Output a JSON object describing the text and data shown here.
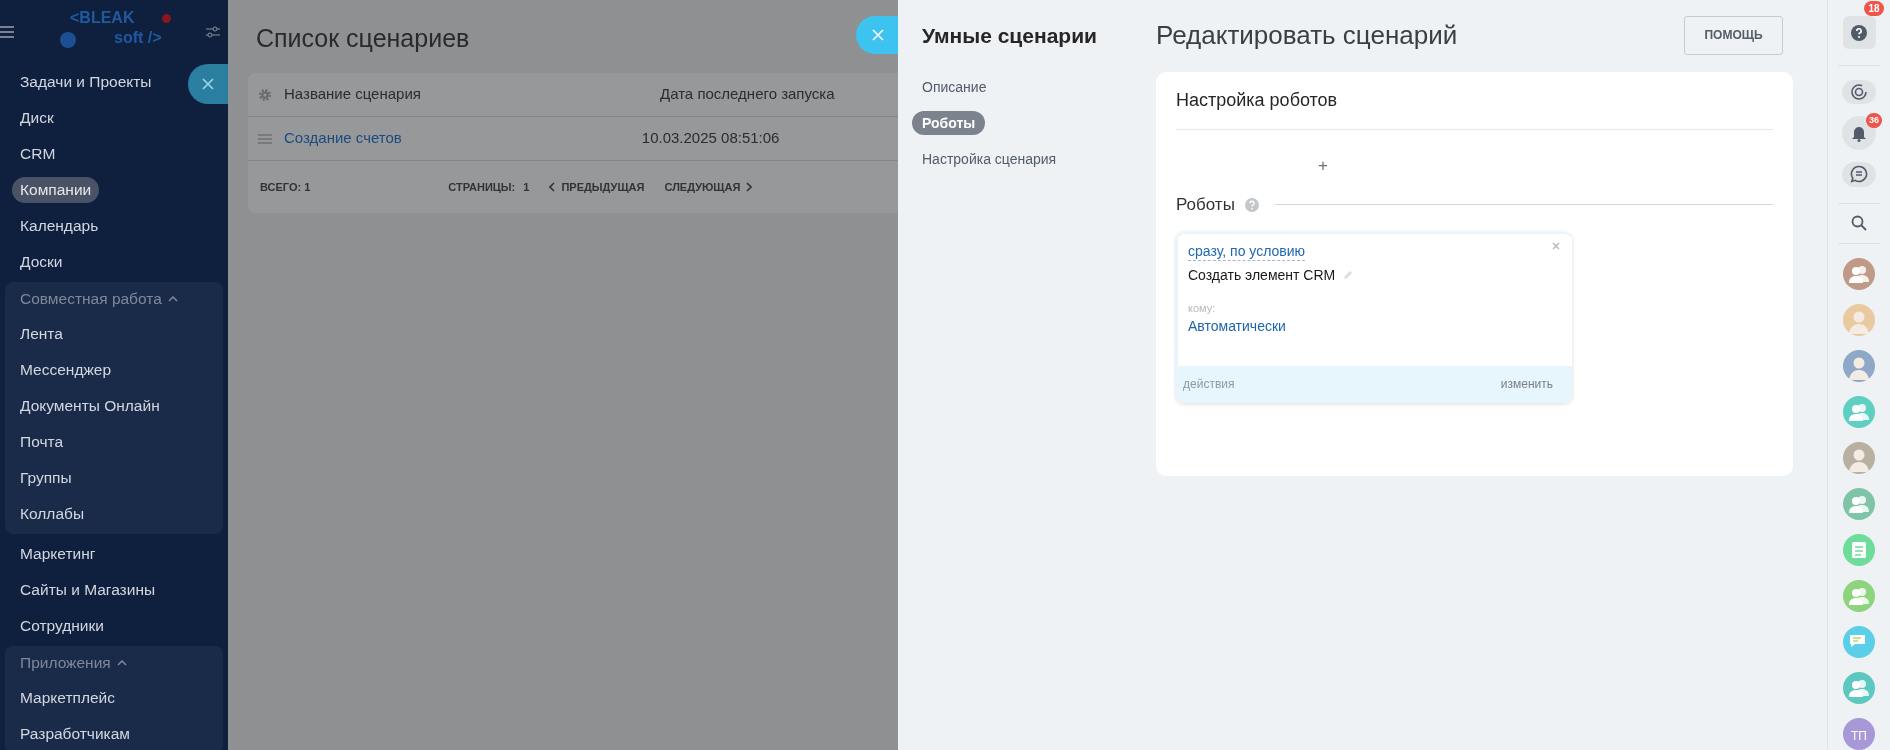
{
  "left_menu": {
    "logo": {
      "line_1": "<BLEAK",
      "line_2": "soft />"
    },
    "items": [
      {
        "kind": "link",
        "label": "Задачи и Проекты",
        "selected": false
      },
      {
        "kind": "link",
        "label": "Диск",
        "selected": false
      },
      {
        "kind": "link",
        "label": "CRM",
        "selected": false
      },
      {
        "kind": "link",
        "label": "Компании",
        "selected": true
      },
      {
        "kind": "link",
        "label": "Календарь",
        "selected": false
      },
      {
        "kind": "link",
        "label": "Доски",
        "selected": false
      },
      {
        "kind": "group",
        "label": "Совместная работа",
        "expanded": true,
        "children": [
          {
            "label": "Лента",
            "selected": false
          },
          {
            "label": "Мессенджер",
            "selected": false
          },
          {
            "label": "Документы Онлайн",
            "selected": false
          },
          {
            "label": "Почта",
            "selected": false
          },
          {
            "label": "Группы",
            "selected": false
          },
          {
            "label": "Коллабы",
            "selected": false
          }
        ]
      },
      {
        "kind": "link",
        "label": "Маркетинг",
        "selected": false
      },
      {
        "kind": "link",
        "label": "Сайты и Магазины",
        "selected": false
      },
      {
        "kind": "link",
        "label": "Сотрудники",
        "selected": false
      },
      {
        "kind": "group",
        "label": "Приложения",
        "expanded": true,
        "children": [
          {
            "label": "Маркетплейс",
            "selected": false
          },
          {
            "label": "Разработчикам",
            "selected": false
          }
        ]
      }
    ]
  },
  "scenario_list": {
    "title": "Список сценариев",
    "columns": [
      "Название сценария",
      "Дата последнего запуска"
    ],
    "rows": [
      {
        "name": "Создание счетов",
        "last_run": "10.03.2025 08:51:06"
      }
    ],
    "footer": {
      "total_label": "ВСЕГО:",
      "total": "1",
      "pages_label": "СТРАНИЦЫ:",
      "page": "1",
      "prev": "ПРЕДЫДУЩАЯ",
      "next": "СЛЕДУЮЩАЯ"
    }
  },
  "panel": {
    "title": "Умные сценарии",
    "nav": [
      {
        "label": "Описание",
        "selected": false
      },
      {
        "label": "Роботы",
        "selected": true
      },
      {
        "label": "Настройка сценария",
        "selected": false
      }
    ],
    "heading": "Редактировать сценарий",
    "help_button": "ПОМОЩЬ",
    "robots_settings": {
      "title": "Настройка роботов",
      "add": "+",
      "section_title": "Роботы",
      "robots": [
        {
          "condition": "сразу, по условию",
          "name": "Создать элемент CRM",
          "to_label": "кому:",
          "to_value": "Автоматически",
          "actions_label": "действия",
          "edit_label": "изменить"
        }
      ]
    }
  },
  "right_bar": {
    "help_badge": "18",
    "notifications_badge": "36",
    "contacts": [
      {
        "kind": "group",
        "color": "#c09a88"
      },
      {
        "kind": "photo",
        "color": "#e8c9a0"
      },
      {
        "kind": "photo",
        "color": "#8fa8c8"
      },
      {
        "kind": "group",
        "color": "#5fcfc3"
      },
      {
        "kind": "photo",
        "color": "#b8b0a0"
      },
      {
        "kind": "group",
        "color": "#7fc4a8"
      },
      {
        "kind": "news",
        "color": "#6edc9a"
      },
      {
        "kind": "group",
        "color": "#8ed47e"
      },
      {
        "kind": "chat",
        "color": "#5ccfe8"
      },
      {
        "kind": "group",
        "color": "#5cc8c0"
      },
      {
        "kind": "initials",
        "color": "#a898d8",
        "initials": "ТП"
      }
    ]
  }
}
